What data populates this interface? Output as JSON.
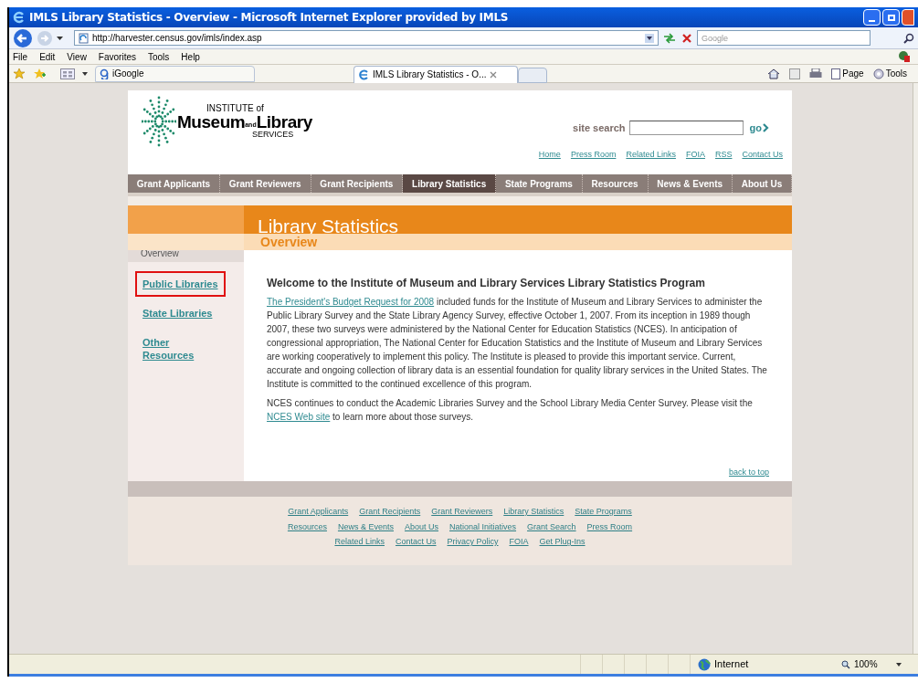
{
  "window": {
    "title": "IMLS Library Statistics - Overview - Microsoft Internet Explorer provided by IMLS"
  },
  "address_bar": {
    "url": "http://harvester.census.gov/imls/index.asp",
    "search_placeholder": "Google"
  },
  "menu": [
    "File",
    "Edit",
    "View",
    "Favorites",
    "Tools",
    "Help"
  ],
  "favorites": {
    "link": "iGoogle"
  },
  "tabs": [
    {
      "label": "IMLS Library Statistics - O...",
      "selected": true
    }
  ],
  "command_bar": [
    "Page",
    "Tools"
  ],
  "page": {
    "logo": {
      "top": "INSTITUTE of",
      "main_1": "Museum",
      "and": "and",
      "main_2": "Library",
      "bottom": "SERVICES"
    },
    "search": {
      "label": "site search",
      "button": "go"
    },
    "top_links": [
      "Home",
      "Press Room",
      "Related Links",
      "FOIA",
      "RSS",
      "Contact Us"
    ],
    "nav": [
      {
        "label": "Grant Applicants",
        "selected": false
      },
      {
        "label": "Grant Reviewers",
        "selected": false
      },
      {
        "label": "Grant Recipients",
        "selected": false
      },
      {
        "label": "Library Statistics",
        "selected": true
      },
      {
        "label": "State Programs",
        "selected": false
      },
      {
        "label": "Resources",
        "selected": false
      },
      {
        "label": "News & Events",
        "selected": false
      },
      {
        "label": "About Us",
        "selected": false
      }
    ],
    "banner": {
      "title": "Library Statistics",
      "subtitle": "Overview"
    },
    "sidebar": [
      {
        "label": "Overview",
        "selected": true,
        "highlighted": false
      },
      {
        "label": "Public Libraries",
        "selected": false,
        "highlighted": true
      },
      {
        "label": "State Libraries",
        "selected": false,
        "highlighted": false
      },
      {
        "label": "Other Resources",
        "selected": false,
        "highlighted": false
      }
    ],
    "heading": "Welcome to the Institute of Museum and Library Services Library Statistics Program",
    "paragraphs": [
      [
        {
          "text": "The President's Budget Request for 2008",
          "link": true
        },
        {
          "text": " included funds for the Institute of Museum and Library Services to administer the Public Library Survey and the State Library Agency Survey, effective October 1, 2007. From its inception in 1989 though 2007, these two surveys were administered by the National Center for Education Statistics (NCES). In anticipation of congressional appropriation, The National Center for Education Statistics and the Institute of Museum and Library Services are working cooperatively to implement this policy. The Institute is pleased to provide this important service. Current, accurate and ongoing collection of library data is an essential foundation for quality library services in the United States. The Institute is committed to the continued excellence of this program.",
          "link": false
        }
      ],
      [
        {
          "text": "NCES continues to conduct the Academic Libraries Survey and the School Library Media Center Survey. Please visit the ",
          "link": false
        },
        {
          "text": "NCES Web site",
          "link": true
        },
        {
          "text": " to learn more about those surveys.",
          "link": false
        }
      ]
    ],
    "back_to_top": "back to top",
    "footer_rows": [
      [
        "Grant Applicants",
        "Grant Recipients",
        "Grant Reviewers",
        "Library Statistics",
        "State Programs"
      ],
      [
        "Resources",
        "News & Events",
        "About Us",
        "National Initiatives",
        "Grant Search",
        "Press Room"
      ],
      [
        "Related Links",
        "Contact Us",
        "Privacy Policy",
        "FOIA",
        "Get Plug-Ins"
      ]
    ]
  },
  "status_bar": {
    "zone": "Internet",
    "zoom": "100%"
  }
}
